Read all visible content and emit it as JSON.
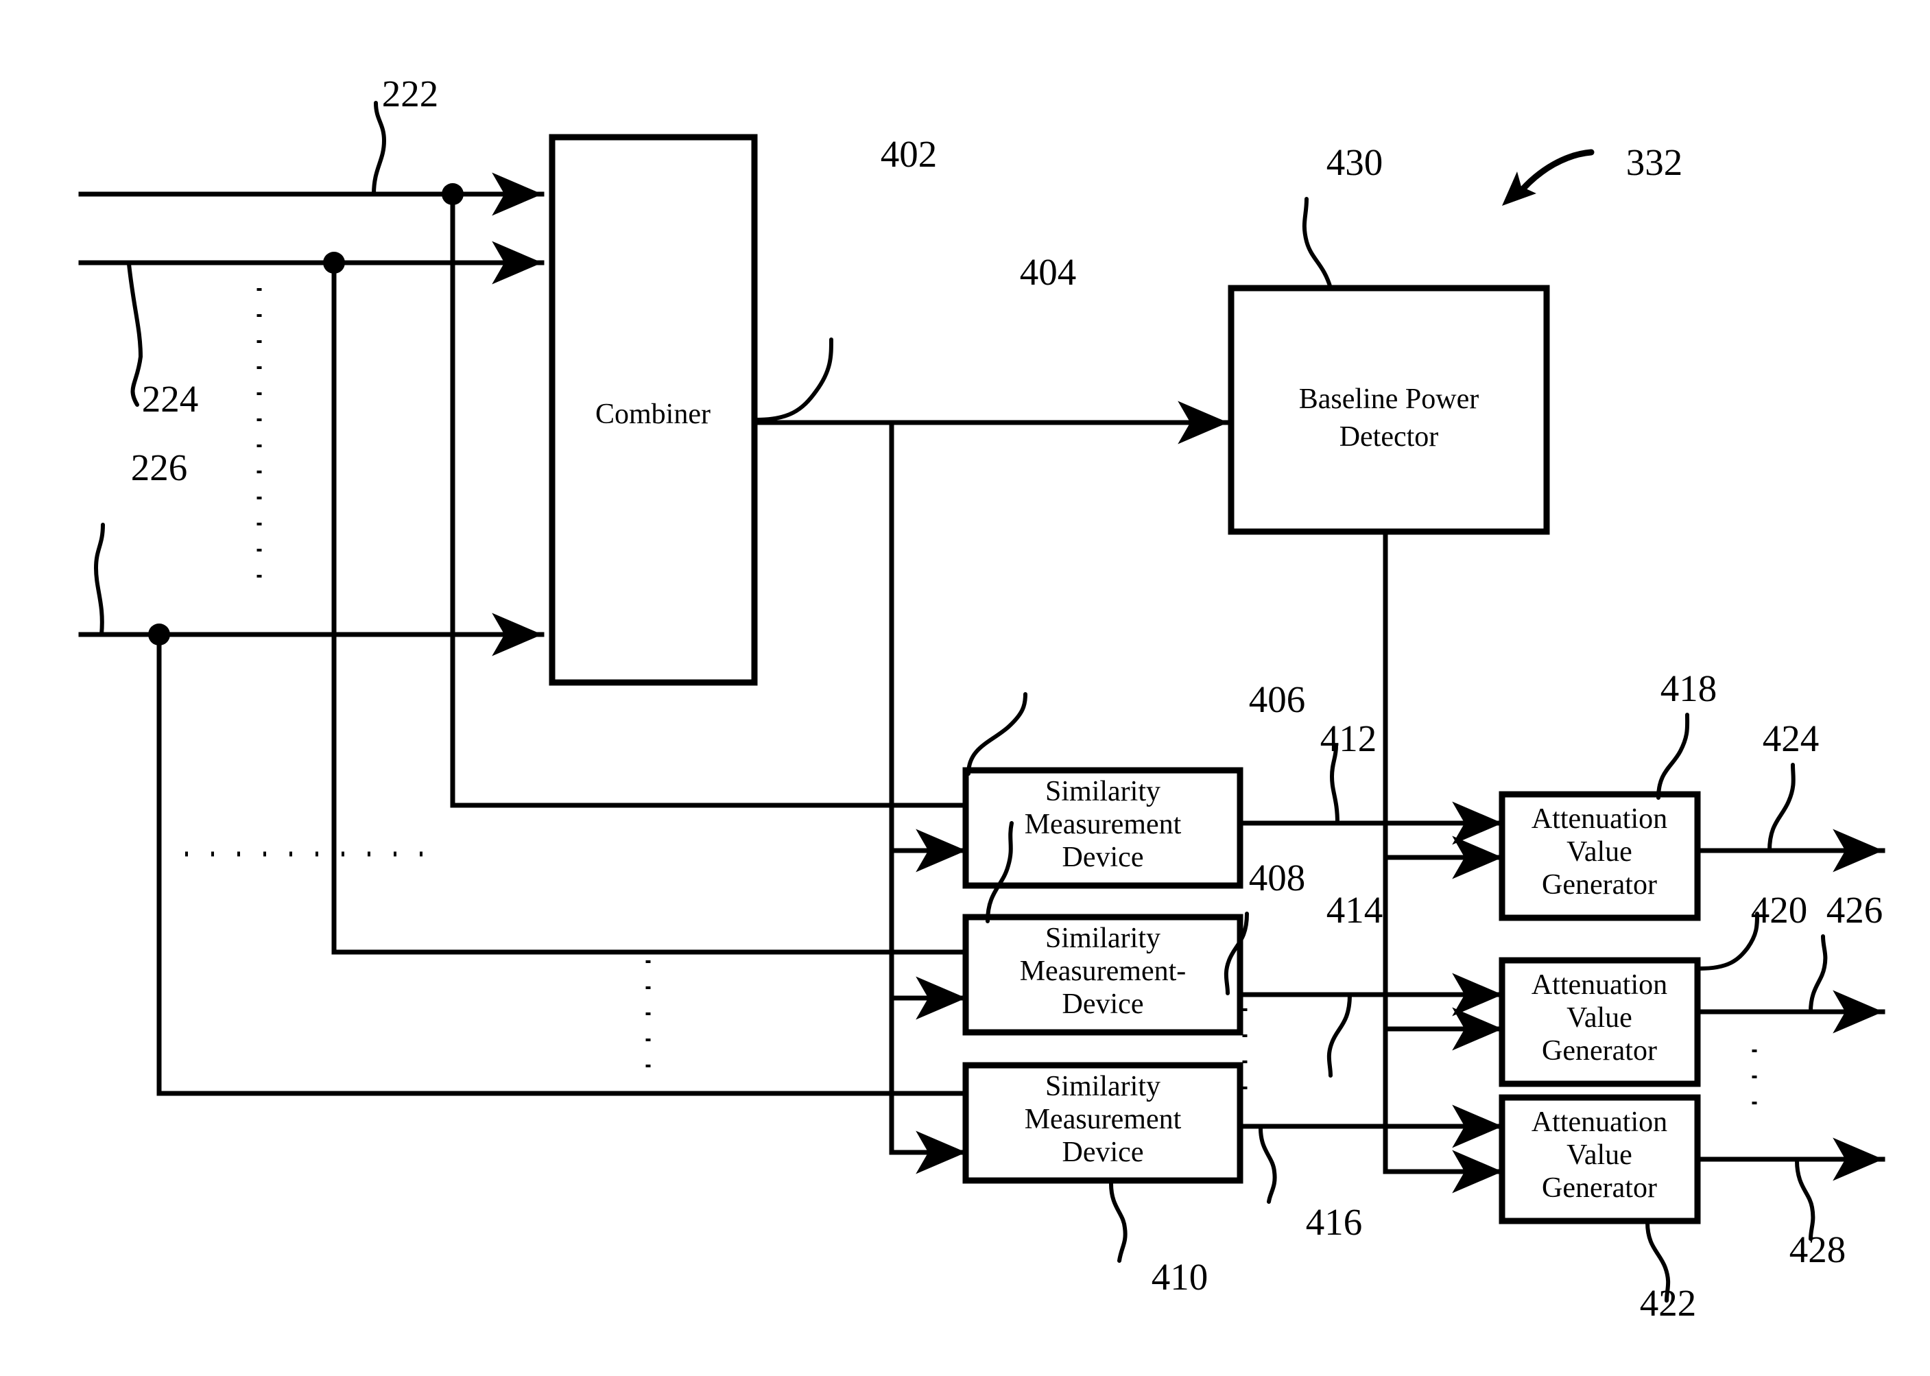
{
  "figure": {
    "title_ref": "332",
    "blocks": {
      "combiner": {
        "label": "Combiner",
        "ref": "402"
      },
      "baseline_power_detector": {
        "line1": "Baseline Power",
        "line2": "Detector",
        "ref": "430"
      },
      "smd1": {
        "line1": "Similarity",
        "line2": "Measurement",
        "line3": "Device",
        "ref": "406"
      },
      "smd2": {
        "line1": "Similarity",
        "line2": "Measurement-",
        "line3": "Device",
        "ref": "408"
      },
      "smd3": {
        "line1": "Similarity",
        "line2": "Measurement",
        "line3": "Device",
        "ref": "410"
      },
      "avg1": {
        "line1": "Attenuation",
        "line2": "Value",
        "line3": "Generator",
        "ref": "418"
      },
      "avg2": {
        "line1": "Attenuation",
        "line2": "Value",
        "line3": "Generator",
        "ref": "420"
      },
      "avg3": {
        "line1": "Attenuation",
        "line2": "Value",
        "line3": "Generator",
        "ref": "422"
      }
    },
    "signal_refs": {
      "input1": "222",
      "input2": "224",
      "input3": "226",
      "combiner_out": "404",
      "smd1_out": "412",
      "smd2_out": "414",
      "smd3_out": "416",
      "avg1_out": "424",
      "avg2_out": "426",
      "avg3_out": "428"
    },
    "ref_labels": [
      "222",
      "224",
      "226",
      "332",
      "402",
      "404",
      "406",
      "408",
      "410",
      "412",
      "414",
      "416",
      "418",
      "420",
      "422",
      "424",
      "426",
      "428",
      "430"
    ]
  }
}
